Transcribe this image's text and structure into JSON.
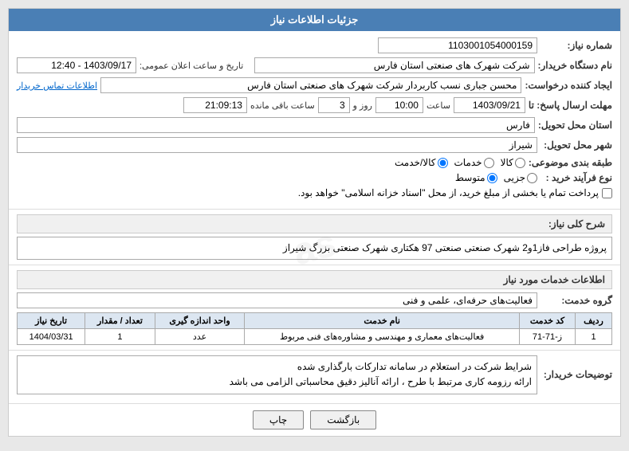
{
  "header": {
    "title": "جزئیات اطلاعات نیاز"
  },
  "form": {
    "shomareNiaz_label": "شماره نیاز:",
    "shomareNiaz_value": "1103001054000159",
    "namDastgah_label": "نام دستگاه خریدار:",
    "namDastgah_value": "شرکت شهرک های صنعتی استان فارس",
    "tarikh_label": "تاریخ و ساعت اعلان عمومی:",
    "tarikh_value": "1403/09/17 - 12:40",
    "ijadKonande_label": "ایجاد کننده درخواست:",
    "ijadKonande_value": "محسن جباری نسب کاربردار شرکت شهرک های صنعتی استان فارس",
    "ettelaatTamas_label": "اطلاعات تماس خریدار",
    "mohlatErsalPasokh_label": "مهلت ارسال پاسخ: تا",
    "date_label": "1403/09/21",
    "saatLabel": "ساعت",
    "saat_value": "10:00",
    "roozLabel": "روز و",
    "rooz_value": "3",
    "baqimandeLabel": "ساعت باقی مانده",
    "baqi_value": "21:09:13",
    "ostan_label": "استان محل تحویل:",
    "ostan_value": "فارس",
    "shahr_label": "شهر محل تحویل:",
    "shahr_value": "شیراز",
    "tabaqe_label": "طبقه بندی موضوعی:",
    "radio_kala": "کالا",
    "radio_khadamat": "خدمات",
    "radio_kalaKhadamat": "کالا/خدمت",
    "selected_radio": "kalaKhadamat",
    "noParavand_label": "نوع فرآیند خرید :",
    "noParavand_jozee": "جزیی",
    "noParavand_motavasset": "متوسط",
    "noParavand_selected": "motavasset",
    "pardakht_label": "پرداخت تمام یا بخشی از مبلغ خرید، از محل \"اسناد خزانه اسلامی\" خواهد بود."
  },
  "sharh": {
    "title": "شرح کلی نیاز:",
    "value": "پروژه طراحی فاز1و2 شهرک صنعتی صنعتی 97 هکتاری شهرک صنعتی بزرگ شیراز"
  },
  "ettelaat": {
    "title": "اطلاعات خدمات مورد نیاز",
    "grouhKhadamat_label": "گروه خدمت:",
    "grouhKhadamat_value": "فعالیت‌های حرفه‌ای، علمی و فنی"
  },
  "table": {
    "headers": [
      "ردیف",
      "کد خدمت",
      "نام خدمت",
      "واحد اندازه گیری",
      "تعداد / مقدار",
      "تاریخ نیاز"
    ],
    "rows": [
      {
        "radif": "1",
        "kodKhadamat": "ز-71-71",
        "namKhadamat": "فعالیت‌های معماری و مهندسی و مشاوره‌های فنی مربوط",
        "vahed": "عدد",
        "tedad": "1",
        "tarikh": "1404/03/31"
      }
    ]
  },
  "notes": {
    "title": "توضیحات خریدار:",
    "line1": "شرایط شرکت در استعلام در سامانه تدارکات بارگذاری شده",
    "line2": "ارائه رزومه کاری مرتبط با طرح ، ارائه آنالیز دقیق محاسباتی الزامی می باشد"
  },
  "buttons": {
    "back": "بازگشت",
    "print": "چاپ"
  }
}
